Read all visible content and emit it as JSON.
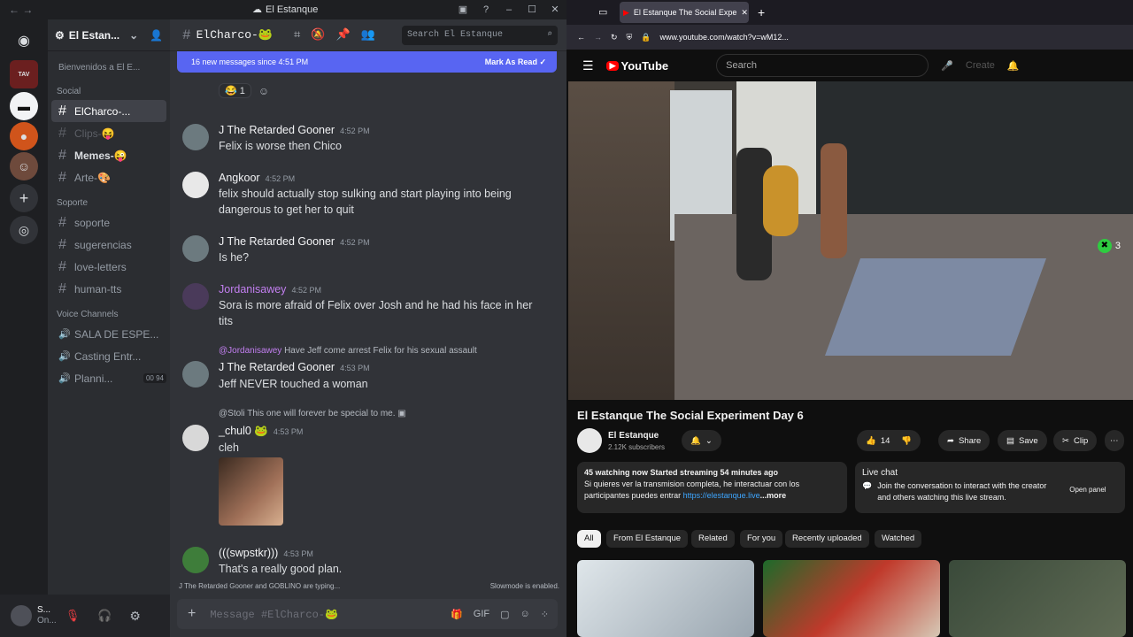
{
  "discord": {
    "window_title": "El Estanque",
    "server_name": "El Estan...",
    "welcome": "Bienvenidos a El E...",
    "channel_name": "ElCharco-🐸",
    "search_placeholder": "Search El Estanque",
    "new_messages": "16 new messages since 4:51 PM",
    "mark_read": "Mark As Read",
    "reaction_count": "1",
    "categories": {
      "social": "Social",
      "soporte": "Soporte",
      "voice": "Voice Channels"
    },
    "channels": [
      {
        "label": "ElCharco-...",
        "active": true
      },
      {
        "label": "Clips-😝",
        "dim": true
      },
      {
        "label": "Memes-😜",
        "bright": true
      },
      {
        "label": "Arte-🎨"
      },
      {
        "label": "soporte"
      },
      {
        "label": "sugerencias"
      },
      {
        "label": "love-letters"
      },
      {
        "label": "human-tts"
      }
    ],
    "voice_channels": [
      {
        "label": "SALA DE ESPE..."
      },
      {
        "label": "Casting Entr..."
      },
      {
        "label": "Planni...",
        "badge1": "00",
        "badge2": "94"
      }
    ],
    "user": {
      "name": "S...",
      "status": "On..."
    },
    "messages": [
      {
        "author": "J The Retarded Gooner",
        "time": "4:52 PM",
        "text": "Felix is worse then Chico"
      },
      {
        "author": "Angkoor",
        "time": "4:52 PM",
        "text": "felix should actually stop sulking and start playing into being dangerous to get her to quit"
      },
      {
        "author": "J The Retarded Gooner",
        "time": "4:52 PM",
        "text": "Is he?"
      },
      {
        "author": "Jordanisawey",
        "time": "4:52 PM",
        "text": "Sora is more afraid of Felix over Josh and he had his face in her tits"
      },
      {
        "reply_mention": "@Jordanisawey",
        "reply_text": "Have Jeff come arrest Felix for his sexual assault",
        "author": "J The Retarded Gooner",
        "time": "4:53 PM",
        "text": "Jeff NEVER touched a woman"
      },
      {
        "reply_mention": "@Stoli",
        "reply_text": "This one will forever be special to me.",
        "author": "_chul0",
        "time": "4:53 PM",
        "text": "cleh"
      },
      {
        "author": "(((swpstkr)))",
        "time": "4:53 PM",
        "text": "That's a really good plan."
      }
    ],
    "typing": "J The Retarded Gooner and GOBLINO are typing...",
    "slowmode": "Slowmode is enabled.",
    "composer_placeholder": "Message #ElCharco-🐸",
    "accent": "#5865f2"
  },
  "browser": {
    "tab_title": "El Estanque The Social Expe",
    "url": "www.youtube.com/watch?v=wM12...",
    "search_placeholder": "Search",
    "logo_text": "YouTube",
    "create": "Create",
    "video_title": "El Estanque The Social Experiment Day 6",
    "channel": "El Estanque",
    "subscribers": "2.12K subscribers",
    "likes": "14",
    "share": "Share",
    "save": "Save",
    "clip": "Clip",
    "overlay_count": "3",
    "desc_line1": "45 watching now  Started streaming 54 minutes ago",
    "desc_line2": "Si quieres ver la transmision completa, he interactuar con los",
    "desc_line3": "participantes puedes entrar",
    "desc_link": "https://elestanque.live",
    "desc_more": "...more",
    "live_chat_title": "Live chat",
    "live_chat_text": "Join the conversation to interact with the creator and others watching this live stream.",
    "open_panel": "Open panel",
    "chips": [
      "All",
      "From El Estanque",
      "Related",
      "For you",
      "Recently uploaded",
      "Watched"
    ],
    "yt_red": "#ff0000"
  }
}
